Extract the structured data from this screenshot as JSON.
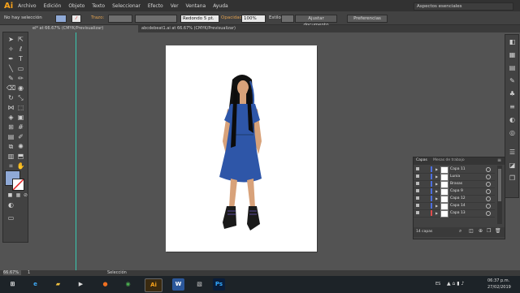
{
  "app": {
    "logo": "Ai"
  },
  "menu": [
    "Archivo",
    "Edición",
    "Objeto",
    "Texto",
    "Seleccionar",
    "Efecto",
    "Ver",
    "Ventana",
    "Ayuda"
  ],
  "workspace": {
    "label": "Aspectos esenciales"
  },
  "control_bar": {
    "selection": "No hay selección",
    "stroke_label": "Trazo:",
    "brush_value": "Redondo 5 pt.",
    "opacity_label": "Opacidad:",
    "opacity_value": "100%",
    "style_label": "Estilo:",
    "doc_setup": "Ajustar documento",
    "preferences": "Preferencias"
  },
  "tabs": [
    {
      "label": "el* at 66.67% (CMYK/Previsualizar)"
    },
    {
      "label": "abcdebeat1.ai at 66.67% (CMYK/Previsualizar)"
    }
  ],
  "layers_panel": {
    "tab_layers": "Capas",
    "tab_artboards": "Mesas de trabajo",
    "count": "14 capas",
    "rows": [
      {
        "name": "Capa 11",
        "color": "#4c6ee0"
      },
      {
        "name": "Lunia",
        "color": "#4c6ee0"
      },
      {
        "name": "Brasas",
        "color": "#4c6ee0"
      },
      {
        "name": "Capa 9",
        "color": "#4c6ee0"
      },
      {
        "name": "Capa 12",
        "color": "#4c6ee0"
      },
      {
        "name": "Capa 14",
        "color": "#4c6ee0"
      },
      {
        "name": "Capa 13",
        "color": "#e04c4c"
      }
    ]
  },
  "status": {
    "zoom": "66.67%",
    "page": "1",
    "mode": "Selección"
  },
  "taskbar": {
    "lang": "ES",
    "time": "06:37 p.m.",
    "date": "27/02/2019"
  },
  "colors": {
    "dress": "#2e56a8",
    "hair": "#111111",
    "skin": "#d8a27a",
    "accent": "#f7a21b"
  }
}
